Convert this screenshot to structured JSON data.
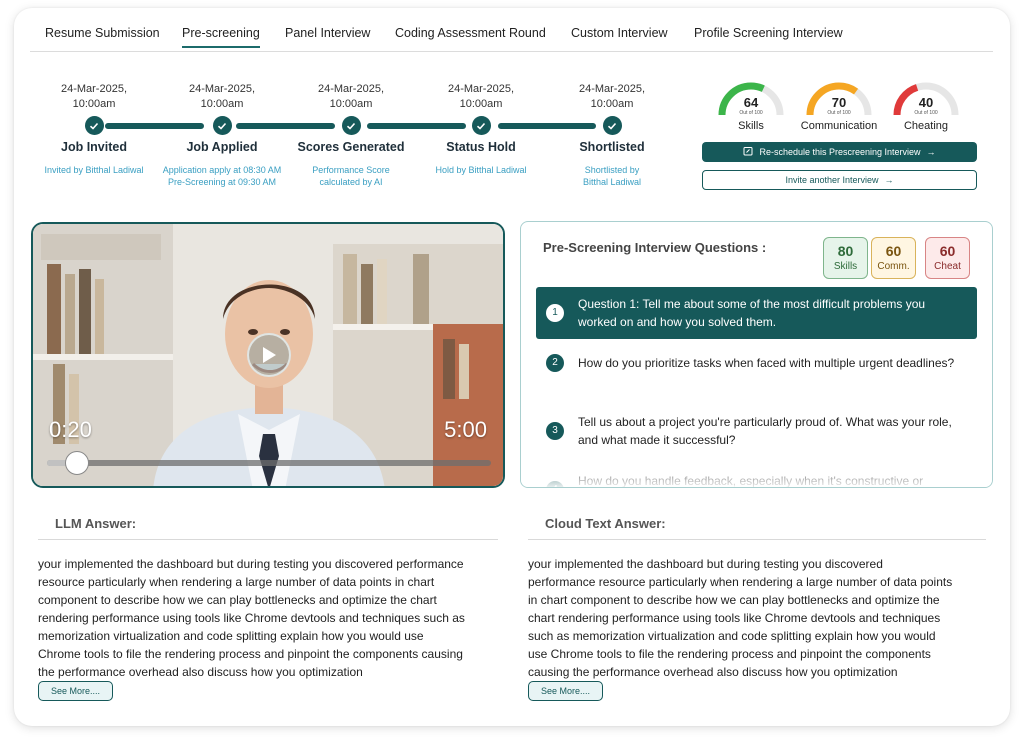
{
  "tabs": [
    {
      "label": "Resume Submission",
      "active": false
    },
    {
      "label": "Pre-screening",
      "active": true
    },
    {
      "label": "Panel Interview",
      "active": false
    },
    {
      "label": "Coding Assessment Round",
      "active": false
    },
    {
      "label": "Custom Interview",
      "active": false
    },
    {
      "label": "Profile Screening Interview",
      "active": false
    }
  ],
  "timeline": [
    {
      "date": "24-Mar-2025,",
      "time": "10:00am",
      "title": "Job Invited",
      "desc": [
        "Invited by Bitthal Ladiwal"
      ]
    },
    {
      "date": "24-Mar-2025,",
      "time": "10:00am",
      "title": "Job Applied",
      "desc": [
        "Application apply at 08:30 AM",
        "Pre-Screening at 09:30 AM"
      ]
    },
    {
      "date": "24-Mar-2025,",
      "time": "10:00am",
      "title": "Scores Generated",
      "desc": [
        "Performance Score",
        "calculated by AI"
      ]
    },
    {
      "date": "24-Mar-2025,",
      "time": "10:00am",
      "title": "Status Hold",
      "desc": [
        "Hold by Bitthal Ladiwal"
      ]
    },
    {
      "date": "24-Mar-2025,",
      "time": "10:00am",
      "title": "Shortlisted",
      "desc": [
        "Shortlisted by",
        "Bitthal Ladiwal"
      ]
    }
  ],
  "gauges": [
    {
      "value": 64,
      "max": 100,
      "sub": "Out of 100",
      "label": "Skills",
      "color": "#3cb54a"
    },
    {
      "value": 70,
      "max": 100,
      "sub": "Out of 100",
      "label": "Communication",
      "color": "#f5a623"
    },
    {
      "value": 40,
      "max": 100,
      "sub": "Out of 100",
      "label": "Cheating",
      "color": "#e03a3a"
    }
  ],
  "actions": {
    "reschedule": "Re-schedule this Prescreening Interview",
    "invite": "Invite another Interview"
  },
  "video": {
    "current": "0:20",
    "total": "5:00",
    "progress": 0.067
  },
  "questions_panel": {
    "title": "Pre-Screening Interview Questions :",
    "badges": {
      "skills": {
        "value": "80",
        "label": "Skills"
      },
      "comm": {
        "value": "60",
        "label": "Comm."
      },
      "cheat": {
        "value": "60",
        "label": "Cheat"
      }
    },
    "items": [
      {
        "num": "1",
        "text": "Question 1: Tell me about some of the most difficult problems you worked on and how you solved them."
      },
      {
        "num": "2",
        "text": "How do you prioritize tasks when faced with multiple urgent deadlines?"
      },
      {
        "num": "3",
        "text": "Tell us about a project you're particularly proud of. What was your role, and what made it successful?"
      },
      {
        "num": "4",
        "text": "How do you handle feedback, especially when it's constructive or"
      }
    ]
  },
  "llm": {
    "heading": "LLM Answer:",
    "lines": [
      "your implemented the dashboard but during testing you discovered performance",
      "resource particularly when rendering a large number of data points in chart",
      "component to describe how we can play bottlenecks and optimize the chart",
      "rendering performance using tools like Chrome devtools and techniques such as",
      "memorization virtualization and code splitting explain how you would use",
      "Chrome tools to file the rendering process and pinpoint the components causing",
      "the performance overhead also discuss how you optimization"
    ],
    "see_more": "See More...."
  },
  "cloud": {
    "heading": "Cloud Text Answer:",
    "lines": [
      "your implemented the dashboard but during testing you discovered",
      "performance resource particularly when rendering a large number of data points",
      "in chart component to describe how we can play bottlenecks and optimize the",
      "chart rendering performance using tools like Chrome devtools and techniques",
      "such as memorization virtualization and code splitting explain how you would",
      "use Chrome tools to file the rendering process and pinpoint the components",
      "causing the performance overhead also discuss how you optimization"
    ],
    "see_more": "See More...."
  }
}
